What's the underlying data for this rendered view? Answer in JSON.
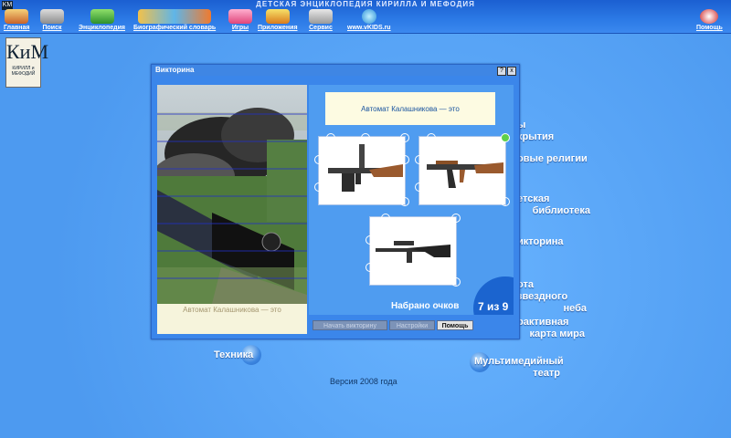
{
  "app": {
    "title": "ДЕТСКАЯ ЭНЦИКЛОПЕДИЯ КИРИЛЛА И МЕФОДИЯ"
  },
  "toolbar": {
    "items": [
      {
        "label": "Главная",
        "icon": "home-icon"
      },
      {
        "label": "Поиск",
        "icon": "search-icon"
      },
      {
        "label": "Энциклопедия",
        "icon": "encyclopedia-icon"
      },
      {
        "label": "Биографический словарь",
        "icon": "biography-icon"
      },
      {
        "label": "Игры",
        "icon": "games-icon"
      },
      {
        "label": "Приложения",
        "icon": "apps-icon"
      },
      {
        "label": "Сервис",
        "icon": "service-icon"
      },
      {
        "label": "www.vKIDS.ru",
        "icon": "globe-icon"
      }
    ],
    "help": {
      "label": "Помощь",
      "icon": "help-icon"
    }
  },
  "logo": {
    "mark": "КиМ",
    "text": "КИРИЛЛ и МЕФОДИЙ"
  },
  "menu": {
    "discoveries_tail": "ы",
    "discoveries_line2": "крытия",
    "religions_tail": "овые религии",
    "library_line1": "етская",
    "library_line2": "библиотека",
    "quiz_tail": "икторина",
    "sky_line1": "ота звездного",
    "sky_line2": "неба",
    "map_line1": "рактивная",
    "map_line2": "карта мира",
    "tech": "Техника",
    "theater_line1": "Мультимедийный",
    "theater_line2": "театр"
  },
  "version": "Версия 2008 года",
  "dialog": {
    "title": "Викторина",
    "help_btn": "?",
    "close_btn": "x",
    "question": "Автомат Калашникова — это",
    "photo_caption": "Автомат Калашникова — это",
    "score_label": "Набрано очков",
    "score_value": "7 из 9",
    "buttons": {
      "start": "Начать викторину",
      "settings": "Настройки",
      "help": "Помощь"
    }
  }
}
